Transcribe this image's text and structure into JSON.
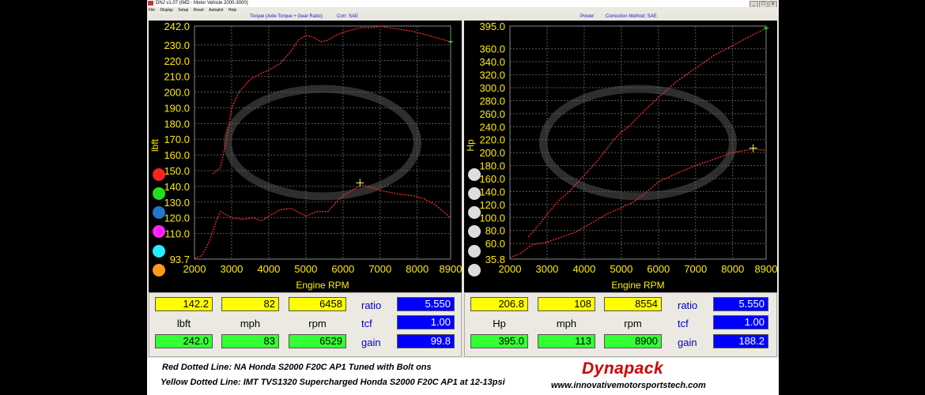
{
  "window": {
    "title": "DNJ v1.07 (IMD - Motor Vehicle 2000-3000)",
    "menu": [
      "File",
      "Display",
      "Setup",
      "Reset",
      "Autoplot",
      "Help"
    ]
  },
  "torque_panel": {
    "header": "Torque (Axle Torque + Gear Ratio):",
    "corr": "Corr: SAE"
  },
  "power_panel": {
    "header": "Power:",
    "corr": "Correction Method: SAE"
  },
  "colors": {
    "axis_text": "#ffeb00",
    "grid": "#5a5a5a",
    "trace": "#ff2a2a",
    "swatches_left": [
      "#ff2020",
      "#22dd22",
      "#2277cc",
      "#ff22ff",
      "#22eeff",
      "#ff9a1a"
    ],
    "swatches_right": [
      "#dddddd",
      "#dddddd",
      "#dddddd",
      "#dddddd",
      "#dddddd",
      "#dddddd"
    ]
  },
  "chart_data": [
    {
      "type": "line",
      "ylabel": "lbft",
      "xlabel": "Engine RPM",
      "xlim": [
        2000,
        8900
      ],
      "ylim": [
        93.7,
        242.0
      ],
      "x_ticks": [
        "2000",
        "3000",
        "4000",
        "5000",
        "6000",
        "7000",
        "8000",
        "8900"
      ],
      "y_ticks": [
        {
          "v": 242.0,
          "t": "242.0"
        },
        {
          "v": 230.0,
          "t": "230.0"
        },
        {
          "v": 220.0,
          "t": "220.0"
        },
        {
          "v": 210.0,
          "t": "210.0"
        },
        {
          "v": 200.0,
          "t": "200.0"
        },
        {
          "v": 190.0,
          "t": "190.0"
        },
        {
          "v": 180.0,
          "t": "180.0"
        },
        {
          "v": 170.0,
          "t": "170.0"
        },
        {
          "v": 160.0,
          "t": "160.0"
        },
        {
          "v": 150.0,
          "t": "150.0"
        },
        {
          "v": 140.0,
          "t": "140.0"
        },
        {
          "v": 130.0,
          "t": "130.0"
        },
        {
          "v": 120.0,
          "t": "120.0"
        },
        {
          "v": 110.0,
          "t": "110.0"
        },
        {
          "v": 93.7,
          "t": "93.7"
        }
      ],
      "series": [
        {
          "x": [
            2500,
            2700,
            2850,
            3000,
            3200,
            3500,
            3800,
            4000,
            4300,
            4600,
            4800,
            5000,
            5200,
            5400,
            5600,
            5800,
            6000,
            6300,
            6500,
            6800,
            7000,
            7200,
            7500,
            7800,
            8000,
            8300,
            8600,
            8900
          ],
          "y": [
            148,
            152,
            168,
            190,
            200,
            208,
            212,
            214,
            218,
            226,
            233,
            236,
            235,
            232,
            233,
            236,
            238,
            240,
            241,
            241,
            242,
            241,
            240,
            239,
            238,
            236,
            234,
            232
          ]
        },
        {
          "x": [
            2000,
            2200,
            2400,
            2600,
            2700,
            3000,
            3300,
            3600,
            3800,
            4000,
            4300,
            4600,
            5000,
            5300,
            5600,
            5900,
            6200,
            6500,
            6800,
            7100,
            7500,
            7900,
            8200,
            8500,
            8900
          ],
          "y": [
            94,
            96,
            105,
            119,
            124,
            120,
            119,
            120,
            118,
            121,
            125,
            126,
            121,
            124,
            124,
            132,
            137,
            141,
            139,
            137,
            135,
            134,
            132,
            128,
            120
          ]
        }
      ],
      "marker": {
        "x": 6458,
        "y": 142.2
      }
    },
    {
      "type": "line",
      "ylabel": "Hp",
      "xlabel": "Engine RPM",
      "xlim": [
        2000,
        8900
      ],
      "ylim": [
        35.8,
        395.0
      ],
      "x_ticks": [
        "2000",
        "3000",
        "4000",
        "5000",
        "6000",
        "7000",
        "8000",
        "8900"
      ],
      "y_ticks": [
        {
          "v": 395.0,
          "t": "395.0"
        },
        {
          "v": 360.0,
          "t": "360.0"
        },
        {
          "v": 340.0,
          "t": "340.0"
        },
        {
          "v": 320.0,
          "t": "320.0"
        },
        {
          "v": 300.0,
          "t": "300.0"
        },
        {
          "v": 280.0,
          "t": "280.0"
        },
        {
          "v": 260.0,
          "t": "260.0"
        },
        {
          "v": 240.0,
          "t": "240.0"
        },
        {
          "v": 220.0,
          "t": "220.0"
        },
        {
          "v": 200.0,
          "t": "200.0"
        },
        {
          "v": 180.0,
          "t": "180.0"
        },
        {
          "v": 160.0,
          "t": "160.0"
        },
        {
          "v": 140.0,
          "t": "140.0"
        },
        {
          "v": 120.0,
          "t": "120.0"
        },
        {
          "v": 100.0,
          "t": "100.0"
        },
        {
          "v": 80.0,
          "t": "80.0"
        },
        {
          "v": 60.0,
          "t": "60.0"
        },
        {
          "v": 35.8,
          "t": "35.8"
        }
      ],
      "series": [
        {
          "x": [
            2500,
            2800,
            3000,
            3300,
            3600,
            4000,
            4400,
            4800,
            5000,
            5200,
            5500,
            6000,
            6500,
            7000,
            7500,
            8000,
            8500,
            8900
          ],
          "y": [
            70,
            90,
            105,
            125,
            140,
            165,
            190,
            220,
            232,
            240,
            258,
            285,
            310,
            330,
            350,
            365,
            380,
            392
          ]
        },
        {
          "x": [
            2000,
            2300,
            2600,
            3000,
            3400,
            3800,
            4000,
            4300,
            4600,
            5000,
            5300,
            5600,
            6000,
            6500,
            7000,
            7500,
            8000,
            8500,
            8900
          ],
          "y": [
            38,
            45,
            58,
            62,
            70,
            78,
            85,
            95,
            105,
            115,
            123,
            135,
            155,
            168,
            180,
            190,
            200,
            205,
            204
          ]
        }
      ],
      "marker": {
        "x": 8554,
        "y": 206.8
      }
    }
  ],
  "torque_readout": {
    "top": [
      "142.2",
      "82",
      "6458"
    ],
    "units": [
      "lbft",
      "mph",
      "rpm"
    ],
    "bottom": [
      "242.0",
      "83",
      "6529"
    ],
    "labels": [
      "ratio",
      "tcf",
      "gain"
    ],
    "blue": [
      "5.550",
      "1.00",
      "99.8"
    ]
  },
  "power_readout": {
    "top": [
      "206.8",
      "108",
      "8554"
    ],
    "units": [
      "Hp",
      "mph",
      "rpm"
    ],
    "bottom": [
      "395.0",
      "113",
      "8900"
    ],
    "labels": [
      "ratio",
      "tcf",
      "gain"
    ],
    "blue": [
      "5.550",
      "1.00",
      "188.2"
    ]
  },
  "footer": {
    "line1": "Red Dotted Line: NA Honda S2000 F20C AP1 Tuned with Bolt ons",
    "line2": "Yellow Dotted Line: IMT TVS1320 Supercharged Honda S2000 F20C AP1 at 12-13psi",
    "brand": "Dynapack",
    "url": "www.innovativemotorsportstech.com"
  }
}
